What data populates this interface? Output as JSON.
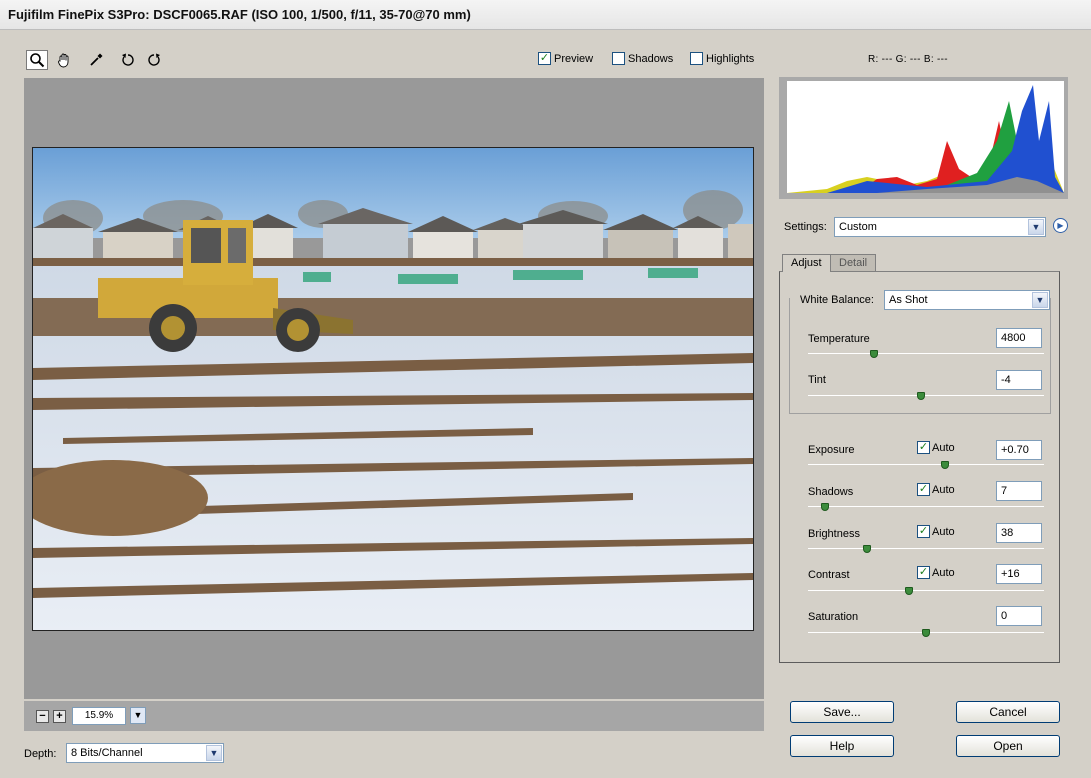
{
  "window": {
    "title": "Fujifilm FinePix S3Pro:  DSCF0065.RAF  (ISO 100, 1/500, f/11, 35-70@70 mm)"
  },
  "toolbar": {
    "tools": [
      "zoom-icon",
      "hand-icon",
      "eyedropper-icon",
      "rotate-left-icon",
      "rotate-right-icon"
    ],
    "preview": {
      "label": "Preview",
      "checked": true
    },
    "shadows": {
      "label": "Shadows",
      "checked": false
    },
    "highlights": {
      "label": "Highlights",
      "checked": false
    }
  },
  "rgb_readout": "R: ---    G: ---    B: ---",
  "zoom": {
    "minus": "−",
    "plus": "+",
    "value": "15.9%",
    "arrow": "▼"
  },
  "depth": {
    "label": "Depth:",
    "value": "8 Bits/Channel"
  },
  "settings": {
    "label": "Settings:",
    "value": "Custom"
  },
  "tabs": {
    "adjust": "Adjust",
    "detail": "Detail"
  },
  "white_balance": {
    "label": "White Balance:",
    "value": "As Shot"
  },
  "sliders": {
    "temperature": {
      "label": "Temperature",
      "value": "4800",
      "level": 0.28
    },
    "tint": {
      "label": "Tint",
      "value": "-4",
      "level": 0.48
    },
    "exposure": {
      "label": "Exposure",
      "auto": "Auto",
      "value": "+0.70",
      "level": 0.58
    },
    "shadows": {
      "label": "Shadows",
      "auto": "Auto",
      "value": "7",
      "level": 0.07
    },
    "brightness": {
      "label": "Brightness",
      "auto": "Auto",
      "value": "38",
      "level": 0.25
    },
    "contrast": {
      "label": "Contrast",
      "auto": "Auto",
      "value": "+16",
      "level": 0.43
    },
    "saturation": {
      "label": "Saturation",
      "value": "0",
      "level": 0.5
    }
  },
  "buttons": {
    "save": "Save...",
    "cancel": "Cancel",
    "help": "Help",
    "open": "Open"
  },
  "colors": {
    "accent": "#1c5180",
    "thumb": "#3c8c3c",
    "preview_bg": "#999999"
  }
}
